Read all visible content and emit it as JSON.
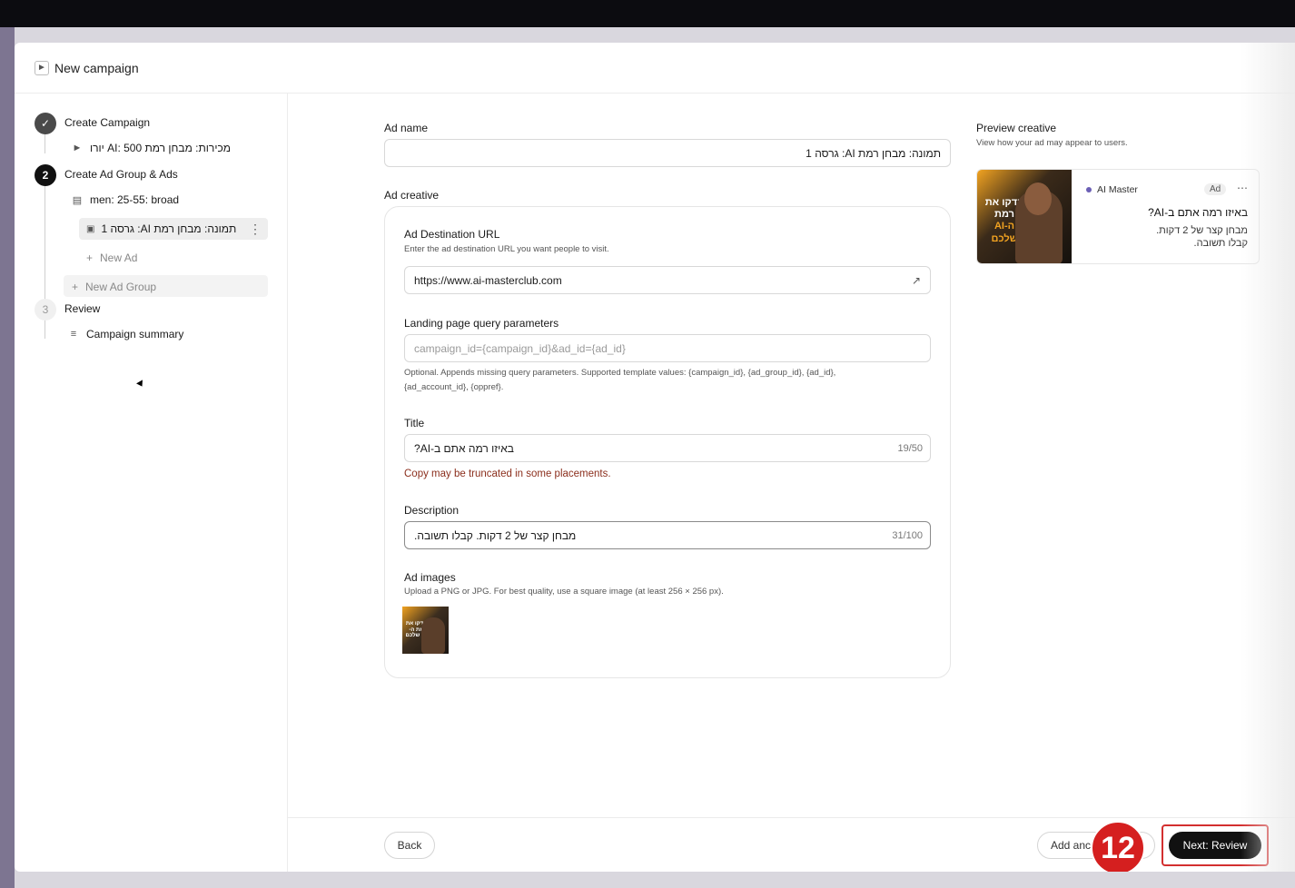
{
  "modal": {
    "title": "New campaign"
  },
  "sidebar": {
    "step1": {
      "number": "",
      "label": "Create Campaign",
      "campaign": "מכירות: מבחן רמת AI: 500 יורו"
    },
    "step2": {
      "number": "2",
      "label": "Create Ad Group & Ads",
      "ad_group": "men: 25-55: broad",
      "ad": "תמונה: מבחן רמת AI: גרסה 1",
      "new_ad": "New Ad",
      "new_ad_group": "New Ad Group"
    },
    "step3": {
      "number": "3",
      "label": "Review",
      "summary": "Campaign summary"
    }
  },
  "form": {
    "ad_name": {
      "label": "Ad name",
      "value": "תמונה: מבחן רמת AI: גרסה 1"
    },
    "ad_creative": {
      "label": "Ad creative"
    },
    "destination_url": {
      "label": "Ad Destination URL",
      "hint": "Enter the ad destination URL you want people to visit.",
      "value": "https://www.ai-masterclub.com"
    },
    "query_params": {
      "label": "Landing page query parameters",
      "placeholder": "campaign_id={campaign_id}&ad_id={ad_id}",
      "hint_line1": "Optional. Appends missing query parameters. Supported template values: {campaign_id}, {ad_group_id}, {ad_id},",
      "hint_line2": "{ad_account_id}, {oppref}."
    },
    "title": {
      "label": "Title",
      "value": "באיזו רמה אתם ב-AI?",
      "counter": "19/50",
      "warning": "Copy may be truncated in some placements."
    },
    "description": {
      "label": "Description",
      "value": "מבחן קצר של 2 דקות. קבלו תשובה.",
      "counter": "31/100"
    },
    "ad_images": {
      "label": "Ad images",
      "hint": "Upload a PNG or JPG. For best quality, use a square image (at least 256 × 256 px).",
      "thumb_text": "בדקו את רמת ה-AI שלכם"
    }
  },
  "preview": {
    "title": "Preview creative",
    "hint": "View how your ad may appear to users.",
    "image_text_1": "בדקו את רמת",
    "image_text_2": "ה-AI שלכם",
    "brand": "AI Master",
    "ad_badge": "Ad",
    "ad_title": "באיזו רמה אתם ב-AI?",
    "ad_desc": "מבחן קצר של 2 דקות. קבלו תשובה."
  },
  "footer": {
    "back": "Back",
    "add_another": "Add anc",
    "next": "Next: Review",
    "step_badge": "12"
  },
  "colors": {
    "accent": "#111111",
    "highlight": "#d32f2f",
    "warning": "#8b2e1c"
  }
}
